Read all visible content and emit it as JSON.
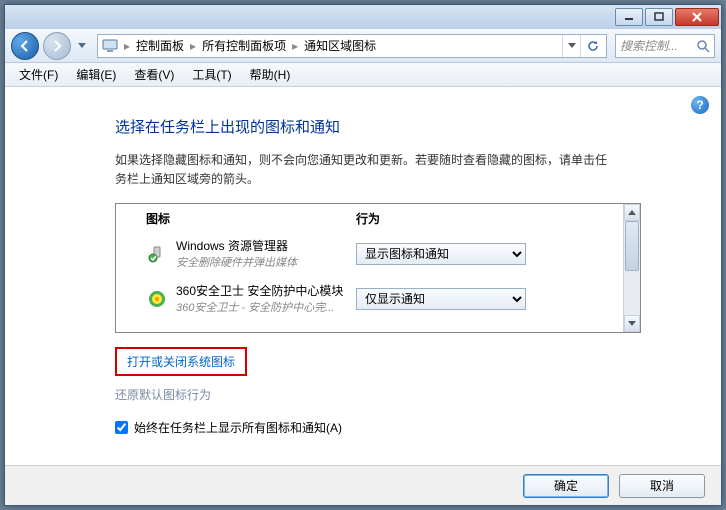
{
  "titlebar": {
    "app_hint1": "",
    "app_hint2": ""
  },
  "breadcrumbs": {
    "root_icon": "monitor",
    "item1": "控制面板",
    "item2": "所有控制面板项",
    "item3": "通知区域图标"
  },
  "search": {
    "placeholder": "搜索控制..."
  },
  "menu": {
    "file": "文件(F)",
    "edit": "编辑(E)",
    "view": "查看(V)",
    "tools": "工具(T)",
    "help": "帮助(H)"
  },
  "page": {
    "heading": "选择在任务栏上出现的图标和通知",
    "description": "如果选择隐藏图标和通知，则不会向您通知更改和更新。若要随时查看隐藏的图标，请单击任务栏上通知区域旁的箭头。"
  },
  "list": {
    "col1": "图标",
    "col2": "行为",
    "rows": [
      {
        "icon": "explorer",
        "title": "Windows 资源管理器",
        "subtitle": "安全删除硬件并弹出媒体",
        "behavior": "显示图标和通知"
      },
      {
        "icon": "360",
        "title": "360安全卫士 安全防护中心模块",
        "subtitle": "360安全卫士 - 安全防护中心完...",
        "behavior": "仅显示通知"
      }
    ]
  },
  "links": {
    "toggle_system_icons": "打开或关闭系统图标",
    "restore_defaults": "还原默认图标行为"
  },
  "checkbox": {
    "label": "始终在任务栏上显示所有图标和通知(A)",
    "checked": true
  },
  "footer": {
    "ok": "确定",
    "cancel": "取消"
  }
}
